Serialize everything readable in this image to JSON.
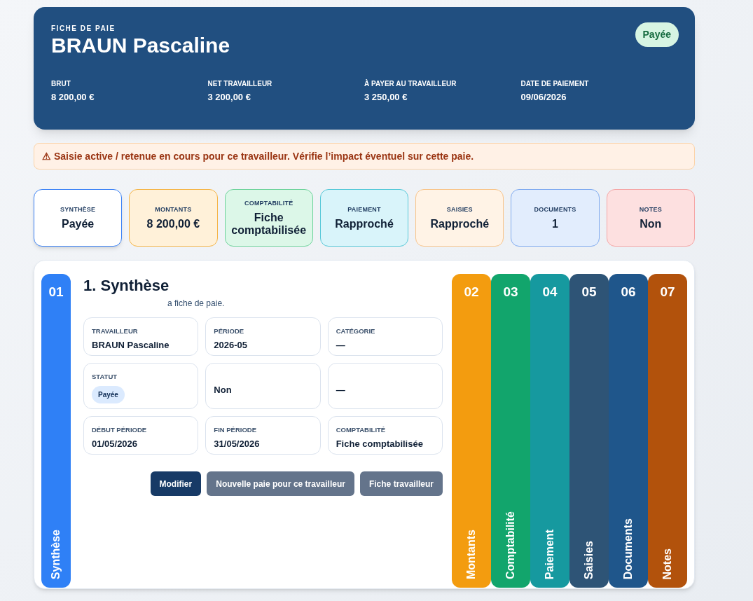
{
  "header": {
    "eyebrow": "FICHE DE PAIE",
    "title": "BRAUN Pascaline",
    "status_badge": "Payée",
    "stats": [
      {
        "label": "BRUT",
        "value": "8 200,00 €"
      },
      {
        "label": "NET TRAVAILLEUR",
        "value": "3 200,00 €"
      },
      {
        "label": "À PAYER AU TRAVAILLEUR",
        "value": "3 250,00 €"
      },
      {
        "label": "DATE DE PAIEMENT",
        "value": "09/06/2026"
      }
    ]
  },
  "alert": {
    "icon": "⚠",
    "text": "Saisie active / retenue en cours pour ce travailleur. Vérifie l’impact éventuel sur cette paie."
  },
  "summary_cards": [
    {
      "label": "SYNTHÈSE",
      "value": "Payée",
      "selected": true
    },
    {
      "label": "MONTANTS",
      "value": "8 200,00 €",
      "selected": false
    },
    {
      "label": "COMPTABILITÉ",
      "value": "Fiche comptabilisée",
      "selected": false
    },
    {
      "label": "PAIEMENT",
      "value": "Rapproché",
      "selected": false
    },
    {
      "label": "SAISIES",
      "value": "Rapproché",
      "selected": false
    },
    {
      "label": "DOCUMENTS",
      "value": "1",
      "selected": false
    },
    {
      "label": "NOTES",
      "value": "Non",
      "selected": false
    }
  ],
  "sections": [
    {
      "number": "01",
      "label": "Synthèse",
      "color": "#2f80f6",
      "expanded": true
    },
    {
      "number": "02",
      "label": "Montants",
      "color": "#f39c0f",
      "expanded": false
    },
    {
      "number": "03",
      "label": "Comptabilité",
      "color": "#12a56c",
      "expanded": false
    },
    {
      "number": "04",
      "label": "Paiement",
      "color": "#16999f",
      "expanded": false
    },
    {
      "number": "05",
      "label": "Saisies",
      "color": "#2e5476",
      "expanded": false
    },
    {
      "number": "06",
      "label": "Documents",
      "color": "#1f568b",
      "expanded": false
    },
    {
      "number": "07",
      "label": "Notes",
      "color": "#b2520c",
      "expanded": false
    }
  ],
  "synthese": {
    "title": "1. Synthèse",
    "description_fragment": "a fiche de paie.",
    "fields": [
      {
        "label": "TRAVAILLEUR",
        "value": "BRAUN Pascaline",
        "kind": "text"
      },
      {
        "label": "PÉRIODE",
        "value": "2026-05",
        "kind": "text"
      },
      {
        "label": "CATÉGORIE",
        "value": "—",
        "kind": "text"
      },
      {
        "label": "STATUT",
        "value": "Payée",
        "kind": "badge"
      },
      {
        "value": "Non",
        "kind": "text"
      },
      {
        "value": "—",
        "kind": "text"
      },
      {
        "label": "DÉBUT PÉRIODE",
        "value": "01/05/2026",
        "kind": "text"
      },
      {
        "label": "FIN PÉRIODE",
        "value": "31/05/2026",
        "kind": "text"
      },
      {
        "label": "COMPTABILITÉ",
        "value": "Fiche comptabilisée",
        "kind": "text"
      }
    ],
    "buttons": [
      {
        "label": "Modifier",
        "kind": "primary"
      },
      {
        "label": "Nouvelle paie pour ce travailleur",
        "kind": "secondary"
      },
      {
        "label": "Fiche travailleur",
        "kind": "secondary"
      }
    ]
  }
}
